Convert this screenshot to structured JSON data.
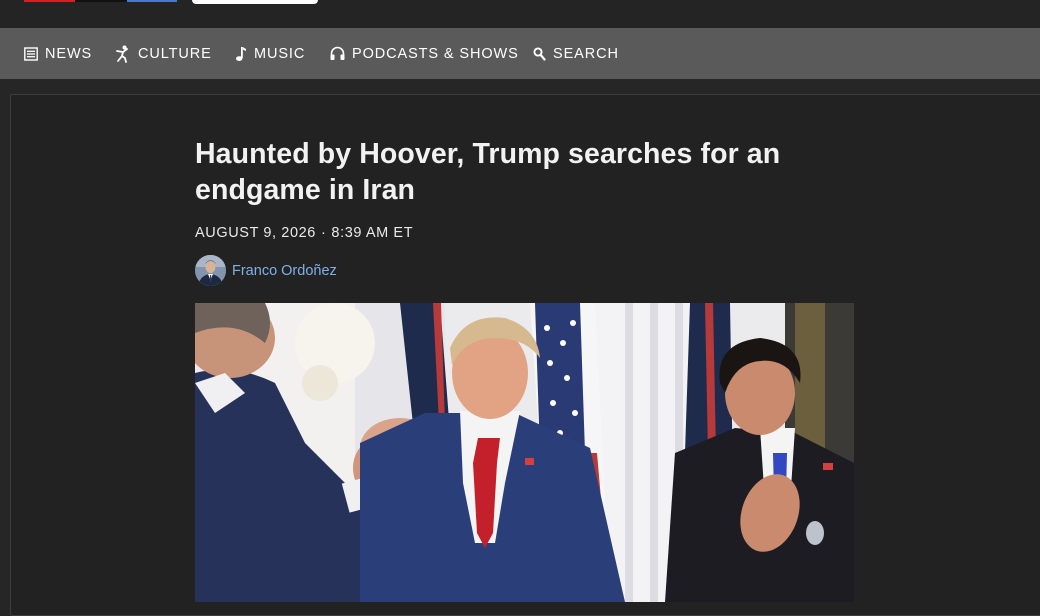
{
  "nav": {
    "items": [
      {
        "label": "NEWS",
        "icon": "newspaper-icon"
      },
      {
        "label": "CULTURE",
        "icon": "dancer-icon"
      },
      {
        "label": "MUSIC",
        "icon": "music-note-icon"
      },
      {
        "label": "PODCASTS & SHOWS",
        "icon": "headphones-icon"
      },
      {
        "label": "SEARCH",
        "icon": "search-icon"
      }
    ]
  },
  "article": {
    "headline": "Haunted by Hoover, Trump searches for an endgame in Iran",
    "date": "AUGUST 9, 2026",
    "separator": "·",
    "time": "8:39 AM ET",
    "author": "Franco Ordoñez"
  },
  "colors": {
    "nav_bg": "#5a5a5a",
    "page_bg": "#262626",
    "author_link": "#7fb0ea"
  }
}
